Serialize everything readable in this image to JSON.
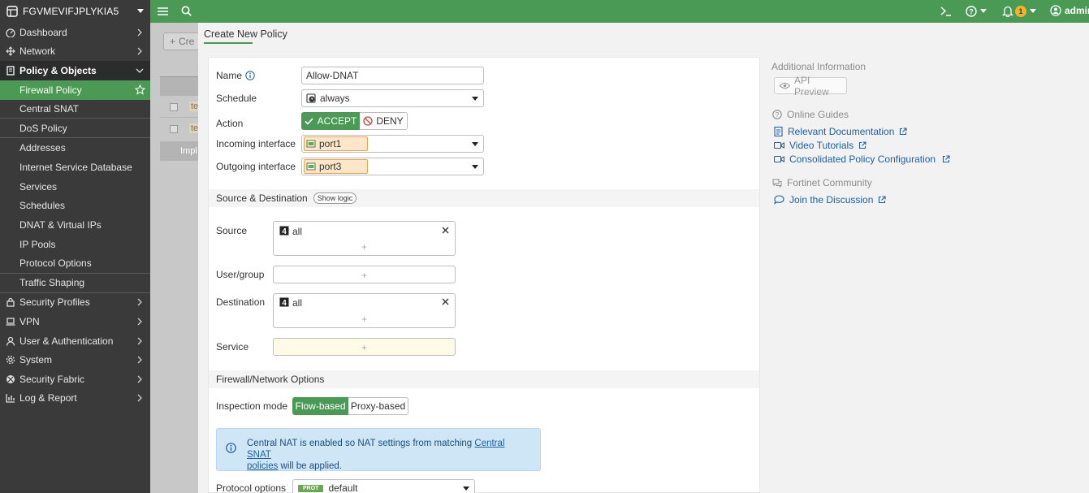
{
  "sidebar": {
    "device_name": "FGVMEVIFJPLYKIA5",
    "items": [
      {
        "label": "Dashboard",
        "icon": "dashboard-icon"
      },
      {
        "label": "Network",
        "icon": "network-icon"
      },
      {
        "label": "Policy & Objects",
        "icon": "policy-icon",
        "open": true
      }
    ],
    "sub_items": [
      "Firewall Policy",
      "Central SNAT",
      "DoS Policy",
      "Addresses",
      "Internet Service Database",
      "Services",
      "Schedules",
      "DNAT & Virtual IPs",
      "IP Pools",
      "Protocol Options",
      "Traffic Shaping"
    ],
    "bottom_items": [
      {
        "label": "Security Profiles",
        "icon": "lock-icon"
      },
      {
        "label": "VPN",
        "icon": "laptop-icon"
      },
      {
        "label": "User & Authentication",
        "icon": "user-icon"
      },
      {
        "label": "System",
        "icon": "gear-icon"
      },
      {
        "label": "Security Fabric",
        "icon": "fabric-icon"
      },
      {
        "label": "Log & Report",
        "icon": "chart-icon"
      }
    ]
  },
  "topbar": {
    "help_label": "?",
    "notifications_count": "1",
    "user_label": "admin"
  },
  "background": {
    "create_label": "Cre",
    "implicit_label": "Impl",
    "cell_label": "te"
  },
  "dialog": {
    "title": "Create New Policy",
    "form": {
      "name_label": "Name",
      "name_value": "Allow-DNAT",
      "schedule_label": "Schedule",
      "schedule_value": "always",
      "action_label": "Action",
      "accept_label": "ACCEPT",
      "deny_label": "DENY",
      "incoming_label": "Incoming interface",
      "incoming_value": "port1",
      "outgoing_label": "Outgoing interface",
      "outgoing_value": "port3"
    },
    "source_dest": {
      "section_title": "Source & Destination",
      "show_logic_label": "Show logic",
      "source_label": "Source",
      "source_value": "all",
      "usergroup_label": "User/group",
      "destination_label": "Destination",
      "destination_value": "all",
      "service_label": "Service",
      "plus": "+"
    },
    "firewall_options": {
      "section_title": "Firewall/Network Options",
      "inspection_label": "Inspection mode",
      "flow_label": "Flow-based",
      "proxy_label": "Proxy-based",
      "nat_info_prefix": "Central NAT is enabled so NAT settings from matching ",
      "nat_info_link1": "Central SNAT",
      "nat_info_link2": "policies",
      "nat_info_suffix": " will be applied.",
      "protocol_label": "Protocol options",
      "protocol_badge": "PROT",
      "protocol_value": "default"
    }
  },
  "info_panel": {
    "additional_title": "Additional Information",
    "api_preview_label": "API Preview",
    "guides_title": "Online Guides",
    "guides": [
      {
        "label": "Relevant Documentation",
        "icon": "document-icon"
      },
      {
        "label": "Video Tutorials",
        "icon": "video-icon"
      },
      {
        "label": "Consolidated Policy Configuration",
        "icon": "video-icon"
      }
    ],
    "community_title": "Fortinet Community",
    "discussion_label": "Join the Discussion"
  },
  "colors": {
    "brand_green": "#4a9a55",
    "sidebar_bg": "#3a3a3a",
    "accent_link": "#1e5f9e",
    "info_box_bg": "#cfe6f7",
    "tag_bg": "#fde7c8"
  }
}
